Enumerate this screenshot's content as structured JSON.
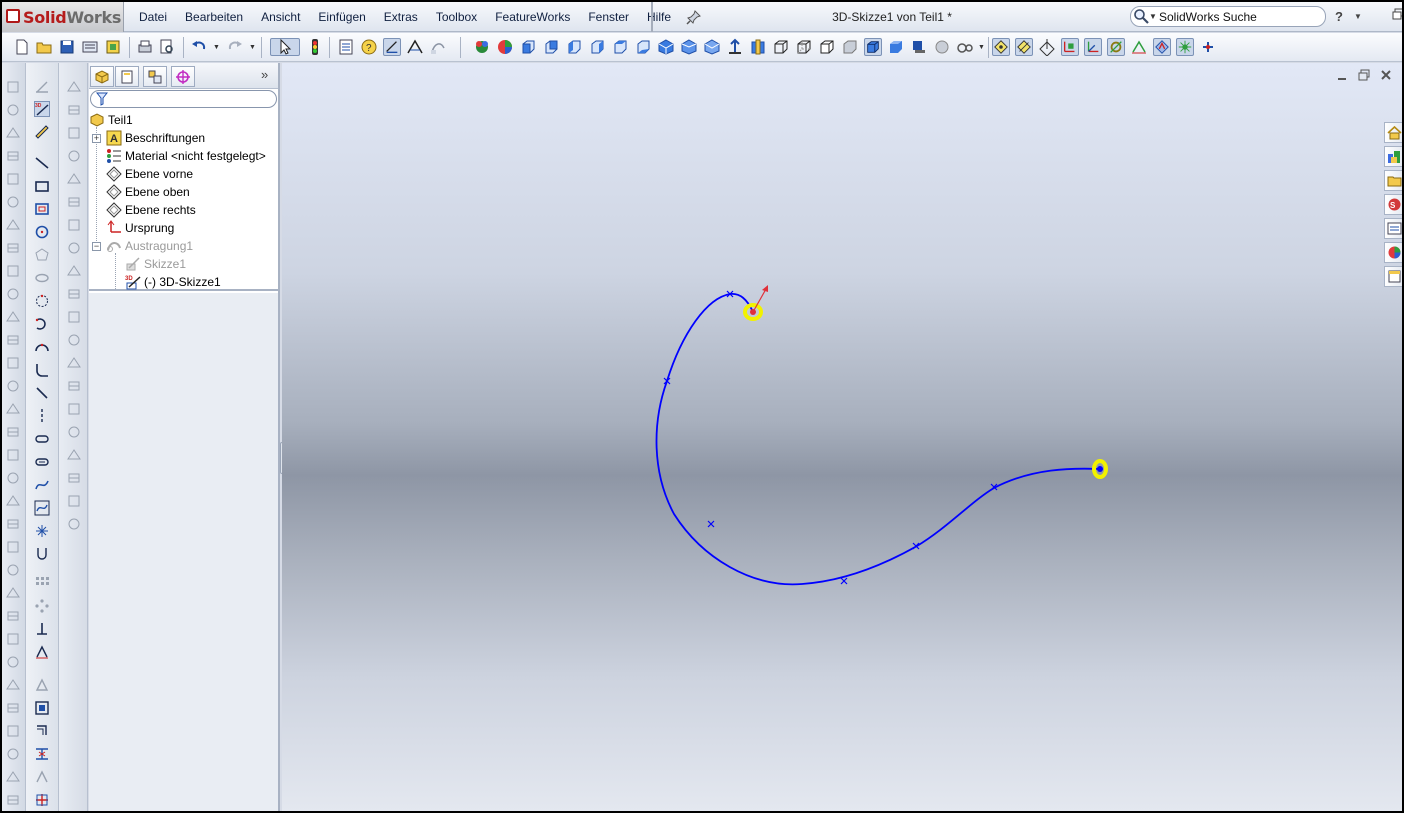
{
  "app": {
    "brand_solid": "Solid",
    "brand_works": "Works",
    "document_title": "3D-Skizze1 von Teil1 *"
  },
  "menu": {
    "items": [
      "Datei",
      "Bearbeiten",
      "Ansicht",
      "Einfügen",
      "Extras",
      "Toolbox",
      "FeatureWorks",
      "Fenster",
      "Hilfe"
    ]
  },
  "search": {
    "value": "SolidWorks Suche"
  },
  "help": {
    "label": "?"
  },
  "feature_tree": {
    "tabs": [
      "featuremanager-tab",
      "propertymanager-tab",
      "configurationmanager-tab",
      "dimxpert-tab"
    ],
    "root": "Teil1",
    "items": [
      {
        "label": "Beschriftungen",
        "icon": "annotations-icon"
      },
      {
        "label": "Material <nicht festgelegt>",
        "icon": "material-icon"
      },
      {
        "label": "Ebene vorne",
        "icon": "plane-icon"
      },
      {
        "label": "Ebene oben",
        "icon": "plane-icon"
      },
      {
        "label": "Ebene rechts",
        "icon": "plane-icon"
      },
      {
        "label": "Ursprung",
        "icon": "origin-icon"
      },
      {
        "label": "Austragung1",
        "icon": "sweep-icon"
      },
      {
        "label": "Skizze1",
        "icon": "sketch-icon"
      },
      {
        "label": "(-) 3D-Skizze1",
        "icon": "3d-sketch-icon"
      }
    ]
  },
  "viewport": {
    "curve_color": "#0000ff",
    "endpoint_highlight": "#f2f200"
  },
  "colors": {
    "accent": "#1f4fa8",
    "brand_red": "#b51c1c"
  }
}
